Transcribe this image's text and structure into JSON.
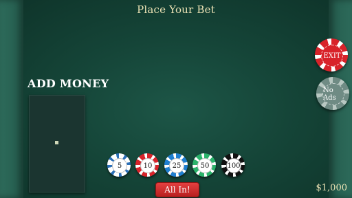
{
  "title": "Place Your Bet",
  "add_money": {
    "label": "ADD MONEY"
  },
  "chips": [
    {
      "label": "5",
      "color": "#ffffff"
    },
    {
      "label": "10",
      "color": "#d8232a"
    },
    {
      "label": "25",
      "color": "#1f7fd1"
    },
    {
      "label": "50",
      "color": "#2bb36b"
    },
    {
      "label": "100",
      "color": "#111111"
    }
  ],
  "side_buttons": {
    "exit": {
      "label": "EXIT",
      "color": "#d8232a"
    },
    "no_ads": {
      "label": "No Ads",
      "color": "#6f8b84"
    }
  },
  "all_in": {
    "label": "All In!"
  },
  "balance": "$1,000"
}
